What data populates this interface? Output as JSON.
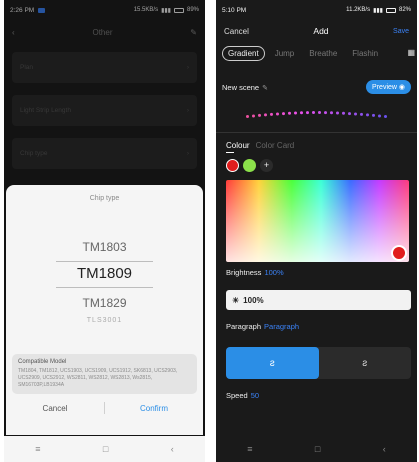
{
  "left": {
    "status": {
      "time": "2:26 PM",
      "net": "15.5KB/s",
      "battery": "89%"
    },
    "header": {
      "back": "‹",
      "title": "Other",
      "edit": "✎"
    },
    "rows": [
      {
        "label": "Plan",
        "value": ""
      },
      {
        "label": "Light Strip Length",
        "value": ""
      },
      {
        "label": "Chip type",
        "value": ""
      }
    ],
    "sheet": {
      "title": "Chip type",
      "options": [
        "TM1803",
        "TM1809",
        "TM1829",
        "TLS3001"
      ],
      "selected_index": 1,
      "compat_title": "Compatible Model",
      "compat_body": "TM1804, TM1812, UCS1903, UCS1909, UCS1912, SK6813, UCS2903, UCS2909, UCS2912, WS2811, WS2812, WS2813, Ws2815, SM16703P,LB1934A",
      "cancel": "Cancel",
      "confirm": "Confirm"
    },
    "nav": {
      "menu": "≡",
      "home": "□",
      "back": "‹"
    }
  },
  "right": {
    "status": {
      "time": "5:10 PM",
      "net": "11.2KB/s",
      "battery": "82%"
    },
    "header": {
      "cancel": "Cancel",
      "title": "Add",
      "save": "Save"
    },
    "tabs": [
      "Gradient",
      "Jump",
      "Breathe",
      "Flashin"
    ],
    "active_tab_index": 0,
    "scene_label": "New scene",
    "preview": "Preview ◉",
    "color_tabs": [
      "Colour",
      "Color Card"
    ],
    "brightness_label": "Brightness",
    "brightness_value": "100%",
    "brightness_display": "100%",
    "paragraph_label": "Paragraph",
    "paragraph_value": "Paragraph",
    "speed_label": "Speed",
    "speed_value": "50",
    "colors": {
      "accent": "#2b8ee6",
      "swatch1": "#e11d1d",
      "swatch2": "#8be04a"
    },
    "nav": {
      "menu": "≡",
      "home": "□",
      "back": "‹"
    }
  }
}
